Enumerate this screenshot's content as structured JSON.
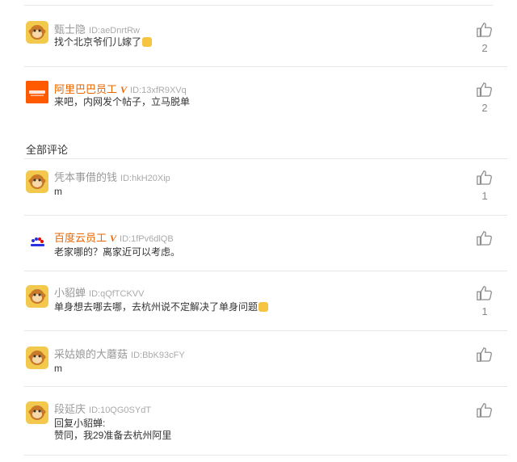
{
  "featured": [
    {
      "name": "甄士隐",
      "id": "ID:aeDnrtRw",
      "text": "找个北京爷们儿嫁了",
      "emoji": true,
      "likes": "2",
      "avatar": "monkey",
      "employee": false
    },
    {
      "name": "阿里巴巴员工",
      "badge": "V",
      "id": "ID:13xfR9XVq",
      "text": "来吧，内网发个帖子，立马脱单",
      "likes": "2",
      "avatar": "alibaba",
      "employee": true
    }
  ],
  "section_title": "全部评论",
  "comments": [
    {
      "name": "凭本事借的钱",
      "id": "ID:hkH20Xip",
      "text": "m",
      "likes": "1",
      "avatar": "monkey",
      "employee": false
    },
    {
      "name": "百度云员工",
      "badge": "V",
      "id": "ID:1fPv6dlQB",
      "text": "老家哪的？离家近可以考虑。",
      "likes": "",
      "avatar": "baidu",
      "employee": true
    },
    {
      "name": "小貂蝉",
      "id": "ID:qQfTCKVV",
      "text": "单身想去哪去哪，去杭州说不定解决了单身问题",
      "emoji": true,
      "likes": "1",
      "avatar": "monkey",
      "employee": false
    },
    {
      "name": "采姑娘的大蘑菇",
      "id": "ID:BbK93cFY",
      "text": "m",
      "likes": "",
      "avatar": "monkey",
      "employee": false
    },
    {
      "name": "段延庆",
      "id": "ID:10QG0SYdT",
      "reply_line": "回复小貂蝉:",
      "text": "赞同，我29准备去杭州阿里",
      "likes": "",
      "avatar": "monkey",
      "employee": false
    }
  ],
  "icons": {
    "like": "thumbs-up-icon",
    "monkey_avatar": "monkey-face-icon",
    "emoji": "smile-emoji-icon"
  },
  "colors": {
    "employee_name": "#e96500",
    "user_name": "#999999",
    "divider": "#e6e6e6",
    "monkey_bg": "#f2c94c",
    "alibaba_bg": "#ff5a00"
  }
}
